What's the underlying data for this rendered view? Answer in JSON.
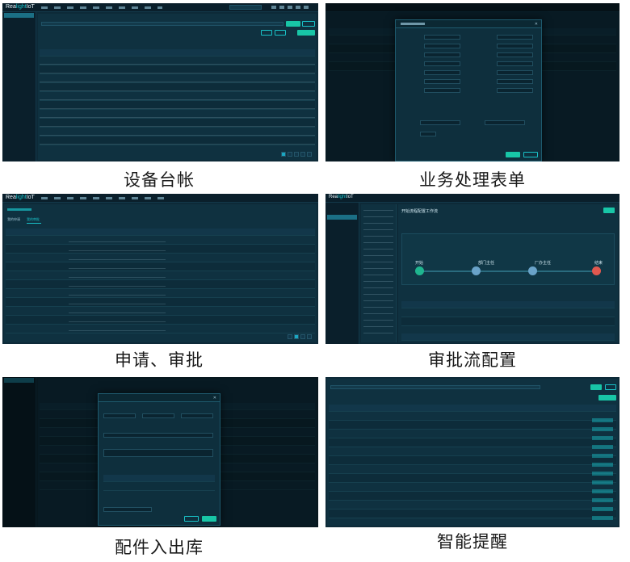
{
  "captions": {
    "p1": "设备台帐",
    "p2": "业务处理表单",
    "p3": "申请、审批",
    "p4": "审批流配置",
    "p5": "配件入出库",
    "p6": "智能提醒"
  },
  "app": {
    "logo_main": "Rea",
    "logo_accent": "light",
    "logo_tail": "IoT"
  },
  "p3": {
    "tab_apply": "我的申请",
    "tab_approve": "我的审批"
  },
  "p4": {
    "title": "开始流程配置工作流",
    "flow": {
      "start": "开始",
      "dept": "部门主任",
      "factory": "厂办主任",
      "end": "结束"
    }
  },
  "colors": {
    "bg": "#0d2a38",
    "accent": "#19c2c8",
    "start_node": "#1fb58f",
    "mid_node": "#6aa3c9",
    "end_node": "#e0584f"
  }
}
